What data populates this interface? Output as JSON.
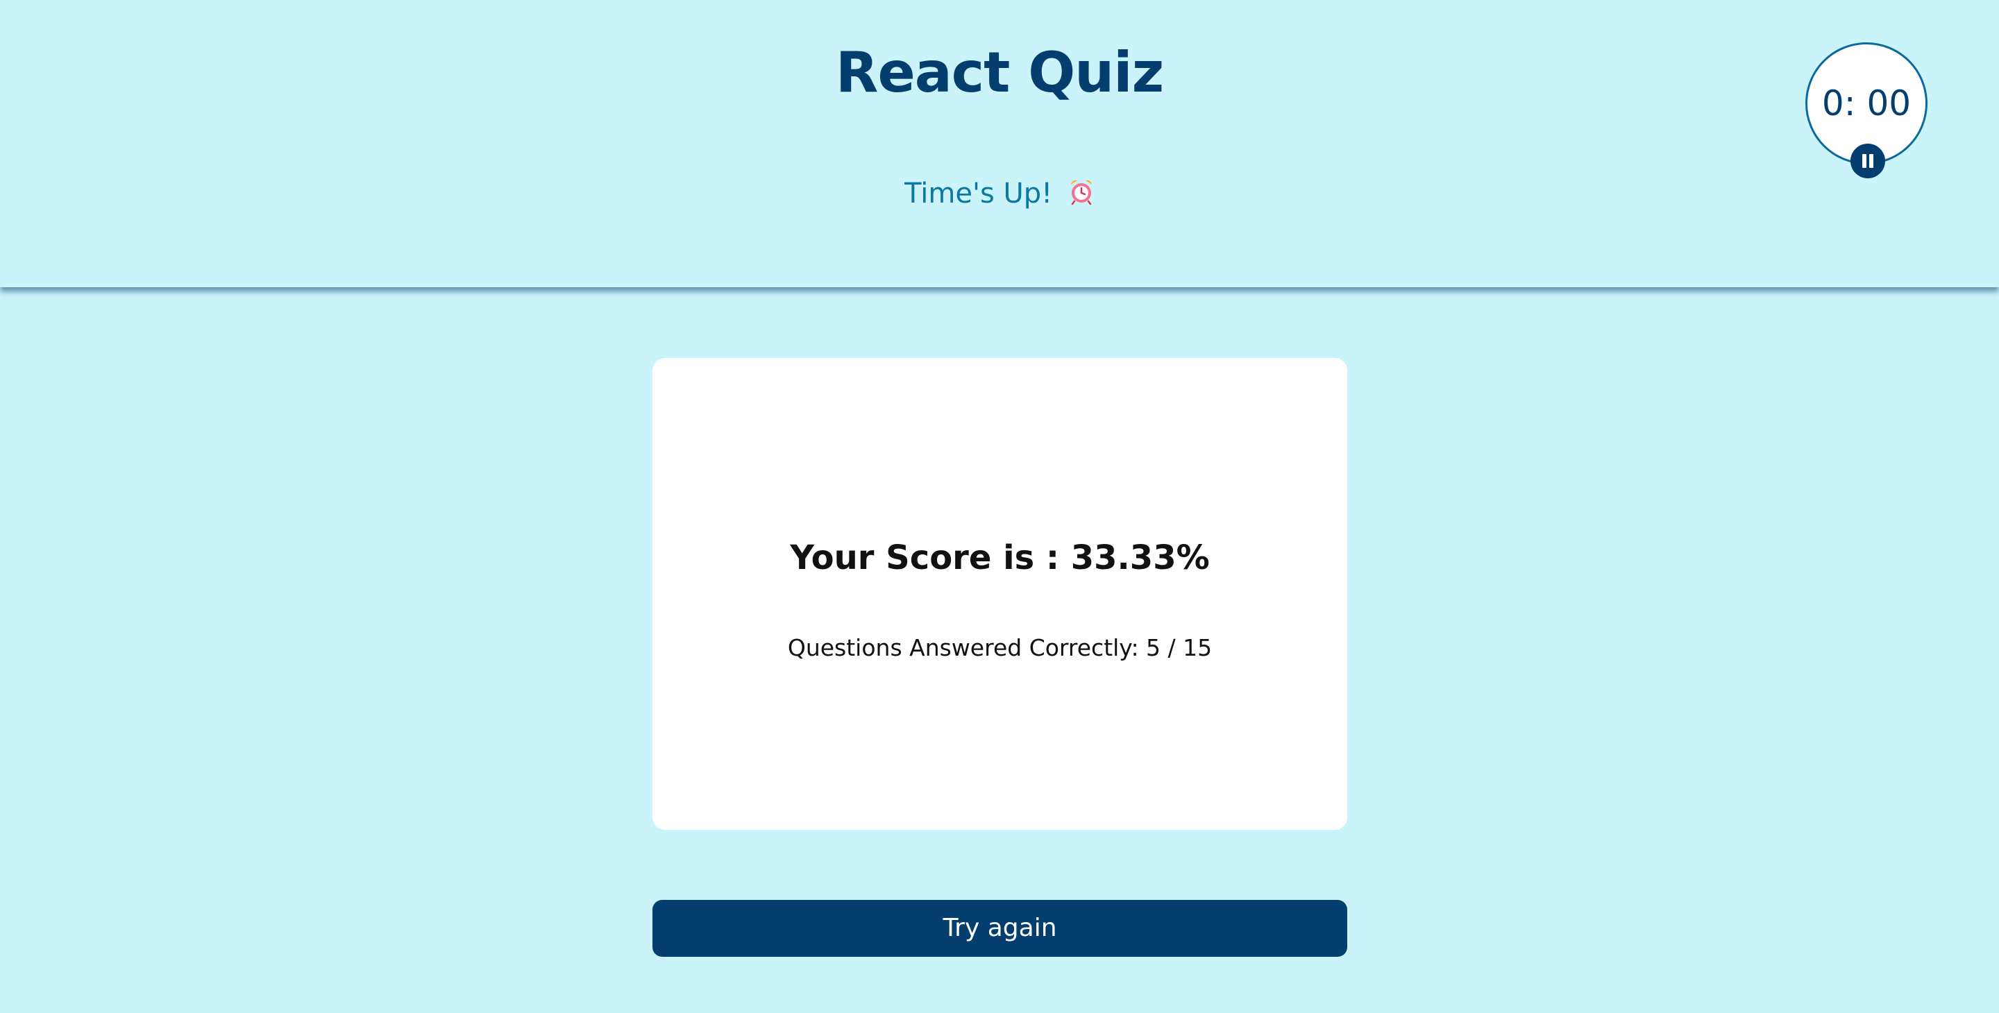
{
  "app": {
    "title": "React Quiz",
    "status_text": "Time's Up!",
    "status_icon": "alarm-clock-icon"
  },
  "timer": {
    "display": "0: 00",
    "pause_icon": "pause-icon"
  },
  "result": {
    "score_text": "Your Score is : 33.33%",
    "answered_text": "Questions Answered Correctly: 5 / 15"
  },
  "actions": {
    "try_again_label": "Try again"
  },
  "colors": {
    "background": "#cbf3fa",
    "primary": "#043e6e",
    "accent": "#0a77a5",
    "card": "#ffffff"
  }
}
